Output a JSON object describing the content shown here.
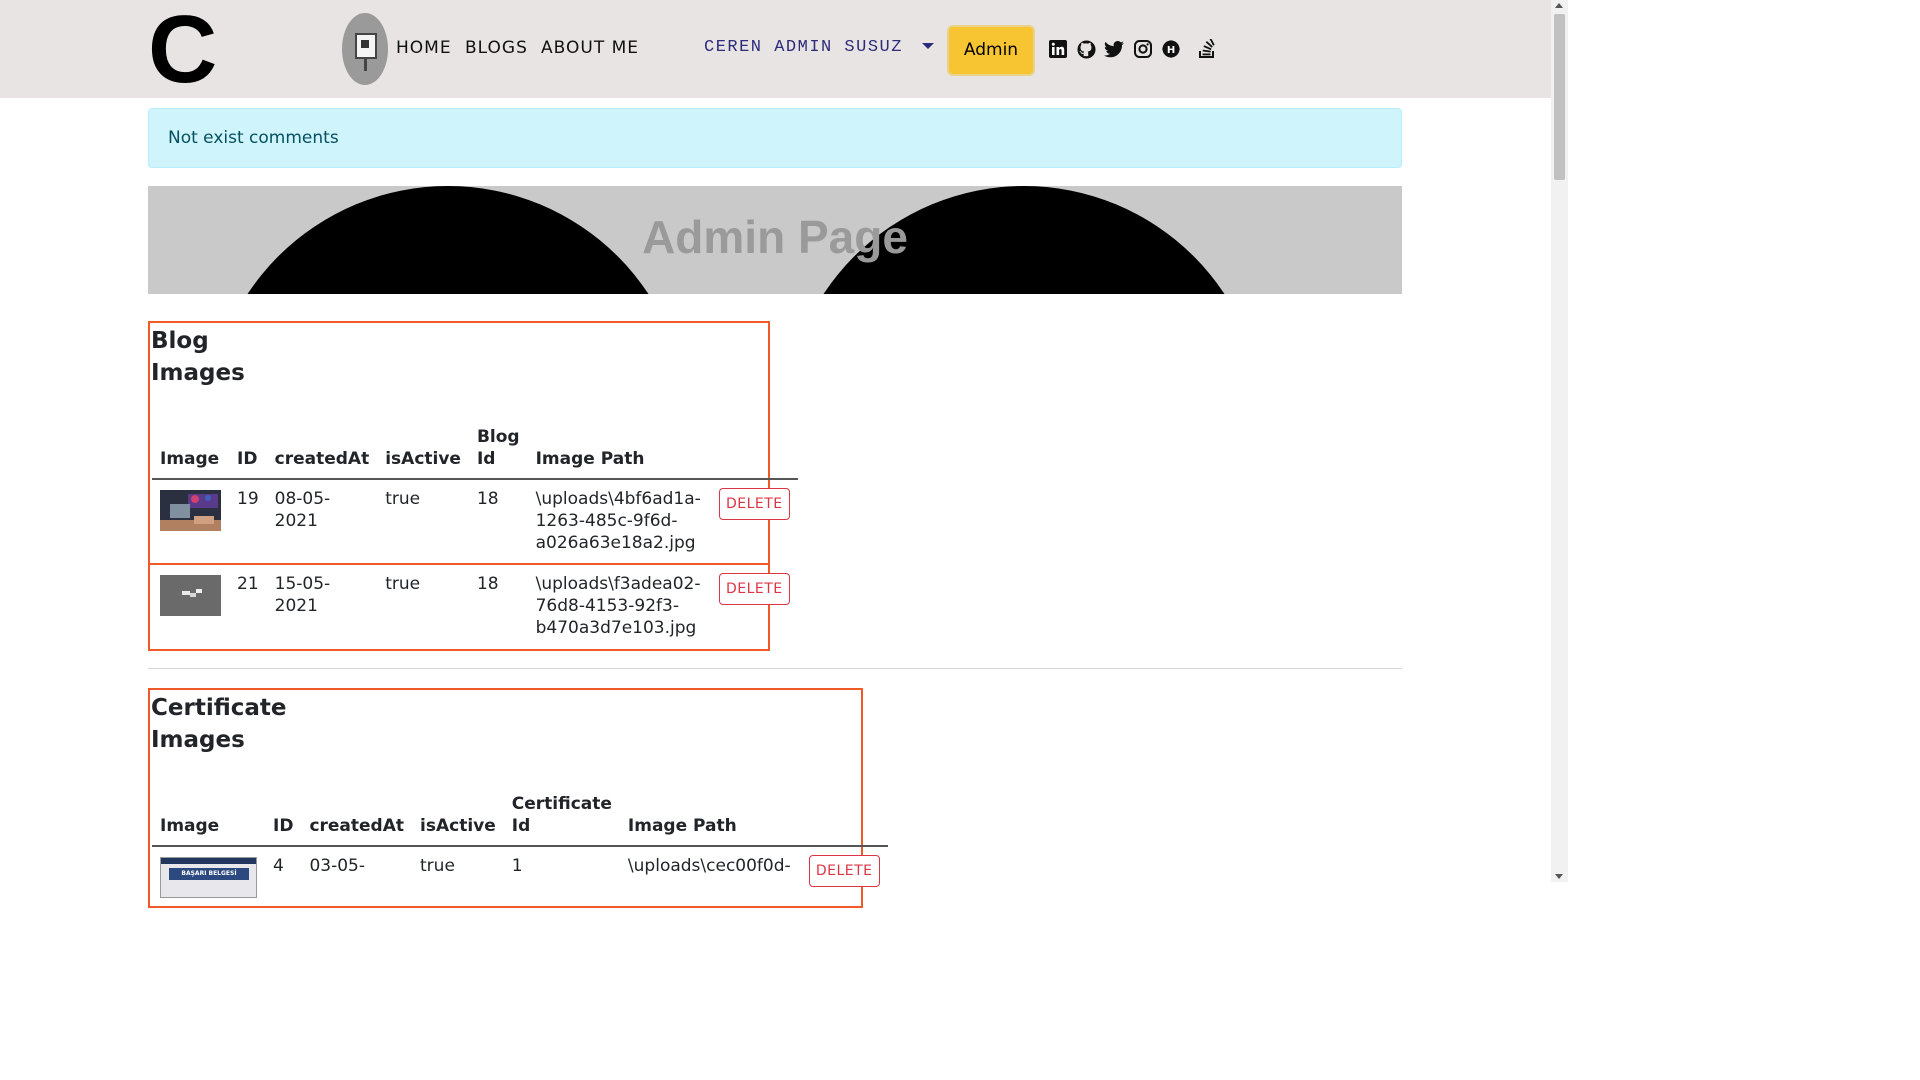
{
  "navbar": {
    "brand": "C",
    "links": [
      "HOME",
      "BLOGS",
      "ABOUT ME"
    ],
    "user_menu": "CEREN ADMIN SUSUZ",
    "admin_button": "Admin",
    "social_icons": [
      "linkedin-icon",
      "github-icon",
      "twitter-icon",
      "instagram-icon",
      "hashnode-icon",
      "stackoverflow-icon"
    ]
  },
  "alert": {
    "text": "Not exist comments"
  },
  "hero": {
    "title": "Admin Page"
  },
  "blog_images": {
    "title_line1": "Blog",
    "title_line2": "Images",
    "headers": {
      "image": "Image",
      "id": "ID",
      "created": "createdAt",
      "active": "isActive",
      "ref_line1": "Blog",
      "ref_line2": "Id",
      "path": "Image Path"
    },
    "rows": [
      {
        "id": "19",
        "created_line1": "08-05-",
        "created_line2": "2021",
        "active": "true",
        "ref": "18",
        "path1": "\\uploads\\4bf6ad1a-",
        "path2": "1263-485c-9f6d-",
        "path3": "a026a63e18a2.jpg",
        "delete": "DELETE"
      },
      {
        "id": "21",
        "created_line1": "15-05-",
        "created_line2": "2021",
        "active": "true",
        "ref": "18",
        "path1": "\\uploads\\f3adea02-",
        "path2": "76d8-4153-92f3-",
        "path3": "b470a3d7e103.jpg",
        "delete": "DELETE"
      }
    ]
  },
  "certificate_images": {
    "title_line1": "Certificate",
    "title_line2": "Images",
    "headers": {
      "image": "Image",
      "id": "ID",
      "created": "createdAt",
      "active": "isActive",
      "ref_line1": "Certificate",
      "ref_line2": "Id",
      "path": "Image Path"
    },
    "rows": [
      {
        "id": "4",
        "created_line1": "03-05-",
        "active": "true",
        "ref": "1",
        "path1": "\\uploads\\cec00f0d-",
        "thumb_text": "BAŞARI BELGESİ",
        "delete": "DELETE"
      }
    ]
  },
  "colors": {
    "navbar_bg": "#e9e4e4",
    "admin_btn": "#f7c531",
    "section_border": "#f05a28",
    "delete": "#dc3545",
    "alert_bg": "#cff4fc"
  }
}
